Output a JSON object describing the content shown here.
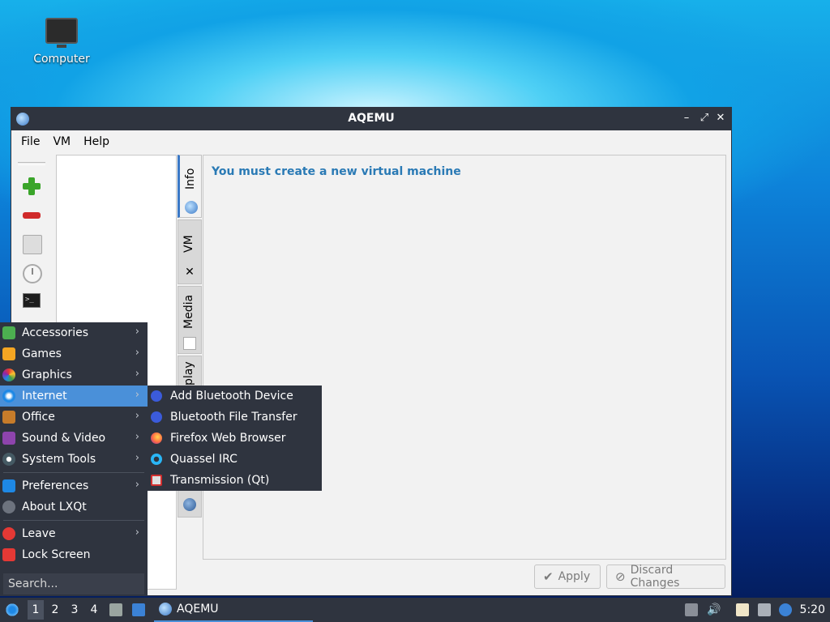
{
  "desktop": {
    "icons": [
      {
        "label": "Computer",
        "icon": "computer-icon"
      }
    ]
  },
  "window": {
    "title": "AQEMU",
    "menus": [
      "File",
      "VM",
      "Help"
    ],
    "toolbar": [
      "add-icon",
      "remove-icon",
      "disk-icon",
      "clock-icon",
      "terminal-icon"
    ],
    "tabs": [
      {
        "label": "Info",
        "icon": "info-globe-icon"
      },
      {
        "label": "VM",
        "icon": "tools-icon"
      },
      {
        "label": "Media",
        "icon": "media-icon"
      },
      {
        "label": "play",
        "icon": "display-icon"
      }
    ],
    "message": "You must create a new virtual machine",
    "buttons": {
      "apply": "Apply",
      "discard": "Discard Changes"
    }
  },
  "start_menu": {
    "items": [
      {
        "label": "Accessories",
        "icon": "accessories-icon",
        "submenu": true
      },
      {
        "label": "Games",
        "icon": "games-icon",
        "submenu": true
      },
      {
        "label": "Graphics",
        "icon": "graphics-icon",
        "submenu": true
      },
      {
        "label": "Internet",
        "icon": "internet-icon",
        "submenu": true,
        "highlighted": true
      },
      {
        "label": "Office",
        "icon": "office-icon",
        "submenu": true
      },
      {
        "label": "Sound & Video",
        "icon": "sound-video-icon",
        "submenu": true
      },
      {
        "label": "System Tools",
        "icon": "system-tools-icon",
        "submenu": true
      }
    ],
    "items2": [
      {
        "label": "Preferences",
        "icon": "preferences-icon",
        "submenu": true
      },
      {
        "label": "About LXQt",
        "icon": "about-icon",
        "submenu": false
      }
    ],
    "items3": [
      {
        "label": "Leave",
        "icon": "leave-icon",
        "submenu": true
      },
      {
        "label": "Lock Screen",
        "icon": "lock-icon",
        "submenu": false
      }
    ],
    "search_placeholder": "Search..."
  },
  "internet_submenu": [
    {
      "label": "Add Bluetooth Device",
      "icon": "bluetooth-icon"
    },
    {
      "label": "Bluetooth File Transfer",
      "icon": "bluetooth-icon"
    },
    {
      "label": "Firefox Web Browser",
      "icon": "firefox-icon"
    },
    {
      "label": "Quassel IRC",
      "icon": "quassel-icon"
    },
    {
      "label": "Transmission (Qt)",
      "icon": "transmission-icon"
    }
  ],
  "taskbar": {
    "workspaces": [
      "1",
      "2",
      "3",
      "4"
    ],
    "active_workspace": "1",
    "task": "AQEMU",
    "clock": "5:20"
  },
  "colors": {
    "panel": "#2f343f",
    "highlight": "#4a90d9",
    "message": "#2a7ab5"
  }
}
